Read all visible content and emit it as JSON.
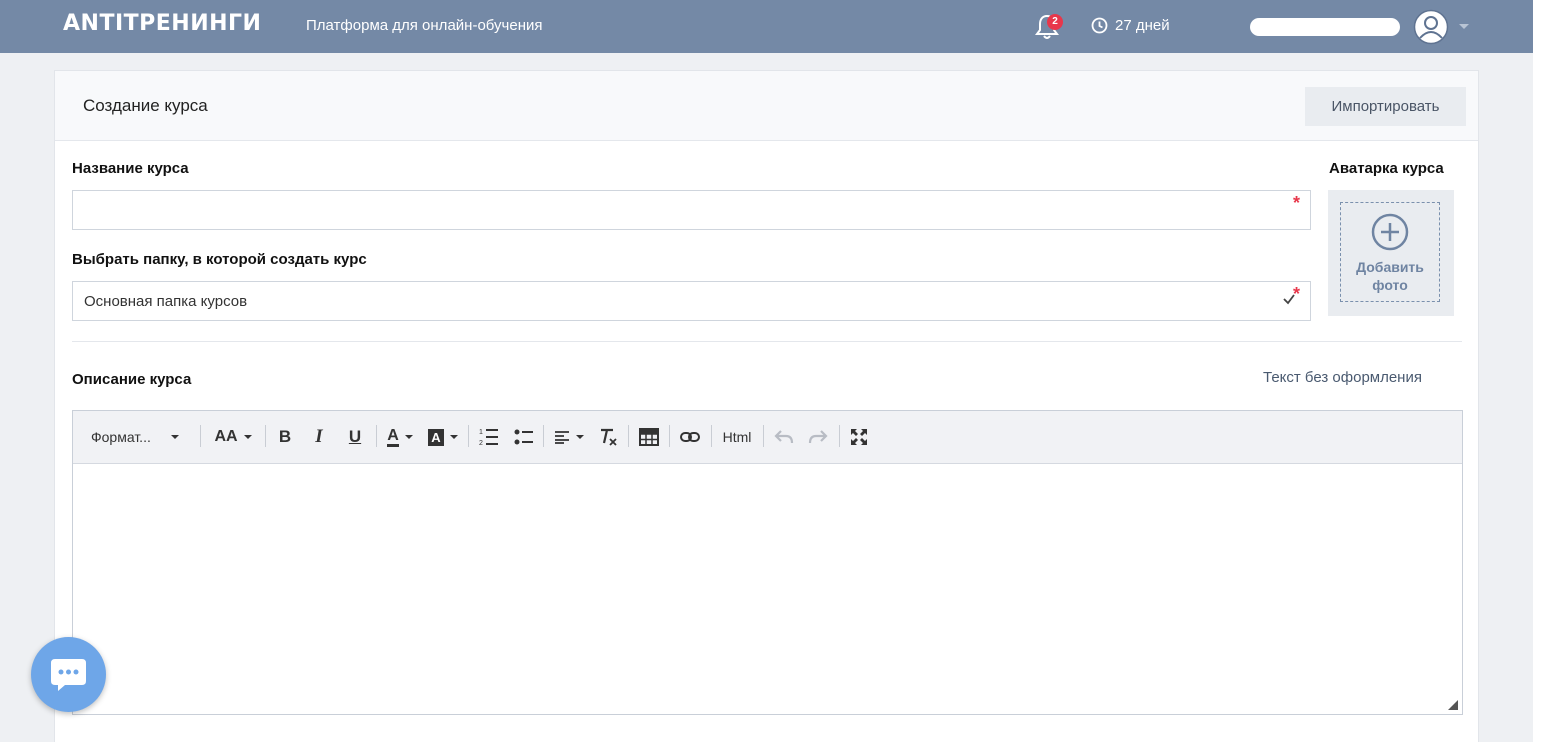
{
  "header": {
    "logo": "ANTITРЕНИНГИ",
    "tagline": "Платформа для онлайн-обучения",
    "notifications_count": "2",
    "days_left": "27 дней"
  },
  "page": {
    "title": "Создание курса",
    "import_label": "Импортировать"
  },
  "form": {
    "course_name_label": "Название курса",
    "course_name_value": "",
    "required_mark": "*",
    "folder_label": "Выбрать папку, в которой создать курс",
    "folder_value": "Основная папка курсов",
    "avatar_label": "Аватарка курса",
    "add_photo_line1": "Добавить",
    "add_photo_line2": "фото",
    "description_label": "Описание курса",
    "plain_text_link": "Текст без оформления"
  },
  "editor": {
    "format_label": "Формат...",
    "font_size_label": "AA",
    "bold_label": "B",
    "italic_label": "I",
    "underline_label": "U",
    "text_color_label": "A",
    "bg_color_label": "A",
    "html_label": "Html",
    "content": ""
  },
  "colors": {
    "header_bg": "#7489a6",
    "accent_red": "#e8374b",
    "chat_bg": "#6ea6e8"
  }
}
